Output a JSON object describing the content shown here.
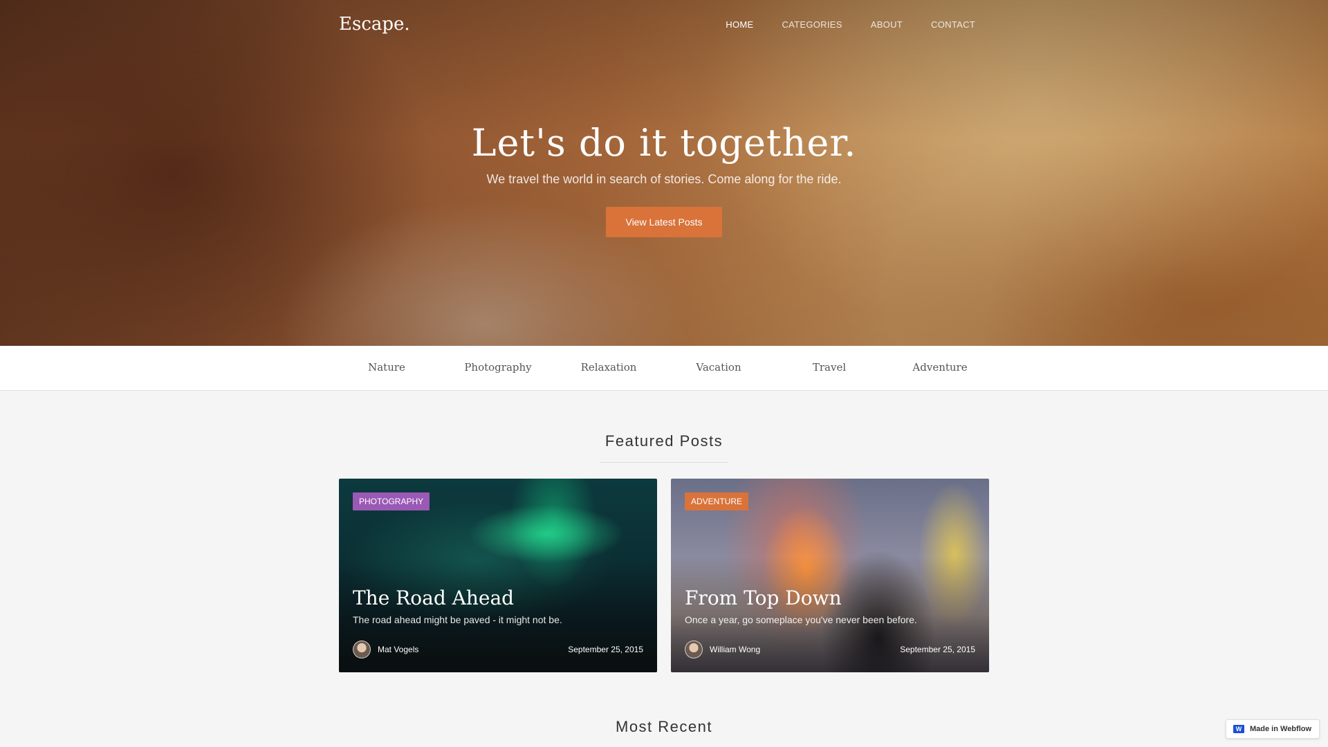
{
  "header": {
    "logo": "Escape.",
    "nav": [
      "HOME",
      "CATEGORIES",
      "ABOUT",
      "CONTACT"
    ]
  },
  "hero": {
    "title": "Let's do it together.",
    "subtitle": "We travel the world in search of stories. Come along for the ride.",
    "button_label": "View Latest Posts"
  },
  "categories": [
    "Nature",
    "Photography",
    "Relaxation",
    "Vacation",
    "Travel",
    "Adventure"
  ],
  "featured": {
    "title": "Featured Posts",
    "posts": [
      {
        "tag": "PHOTOGRAPHY",
        "tag_color": "#9b59b6",
        "title": "The Road Ahead",
        "excerpt": "The road ahead might be paved - it might not be.",
        "author": "Mat Vogels",
        "date": "September 25, 2015"
      },
      {
        "tag": "ADVENTURE",
        "tag_color": "#d9733a",
        "title": "From Top Down",
        "excerpt": "Once a year, go someplace you've never been before.",
        "author": "William Wong",
        "date": "September 25, 2015"
      }
    ]
  },
  "most_recent": {
    "title": "Most Recent"
  },
  "badge": {
    "label": "Made in Webflow"
  },
  "colors": {
    "accent": "#d9733a",
    "background": "#f5f5f5"
  }
}
